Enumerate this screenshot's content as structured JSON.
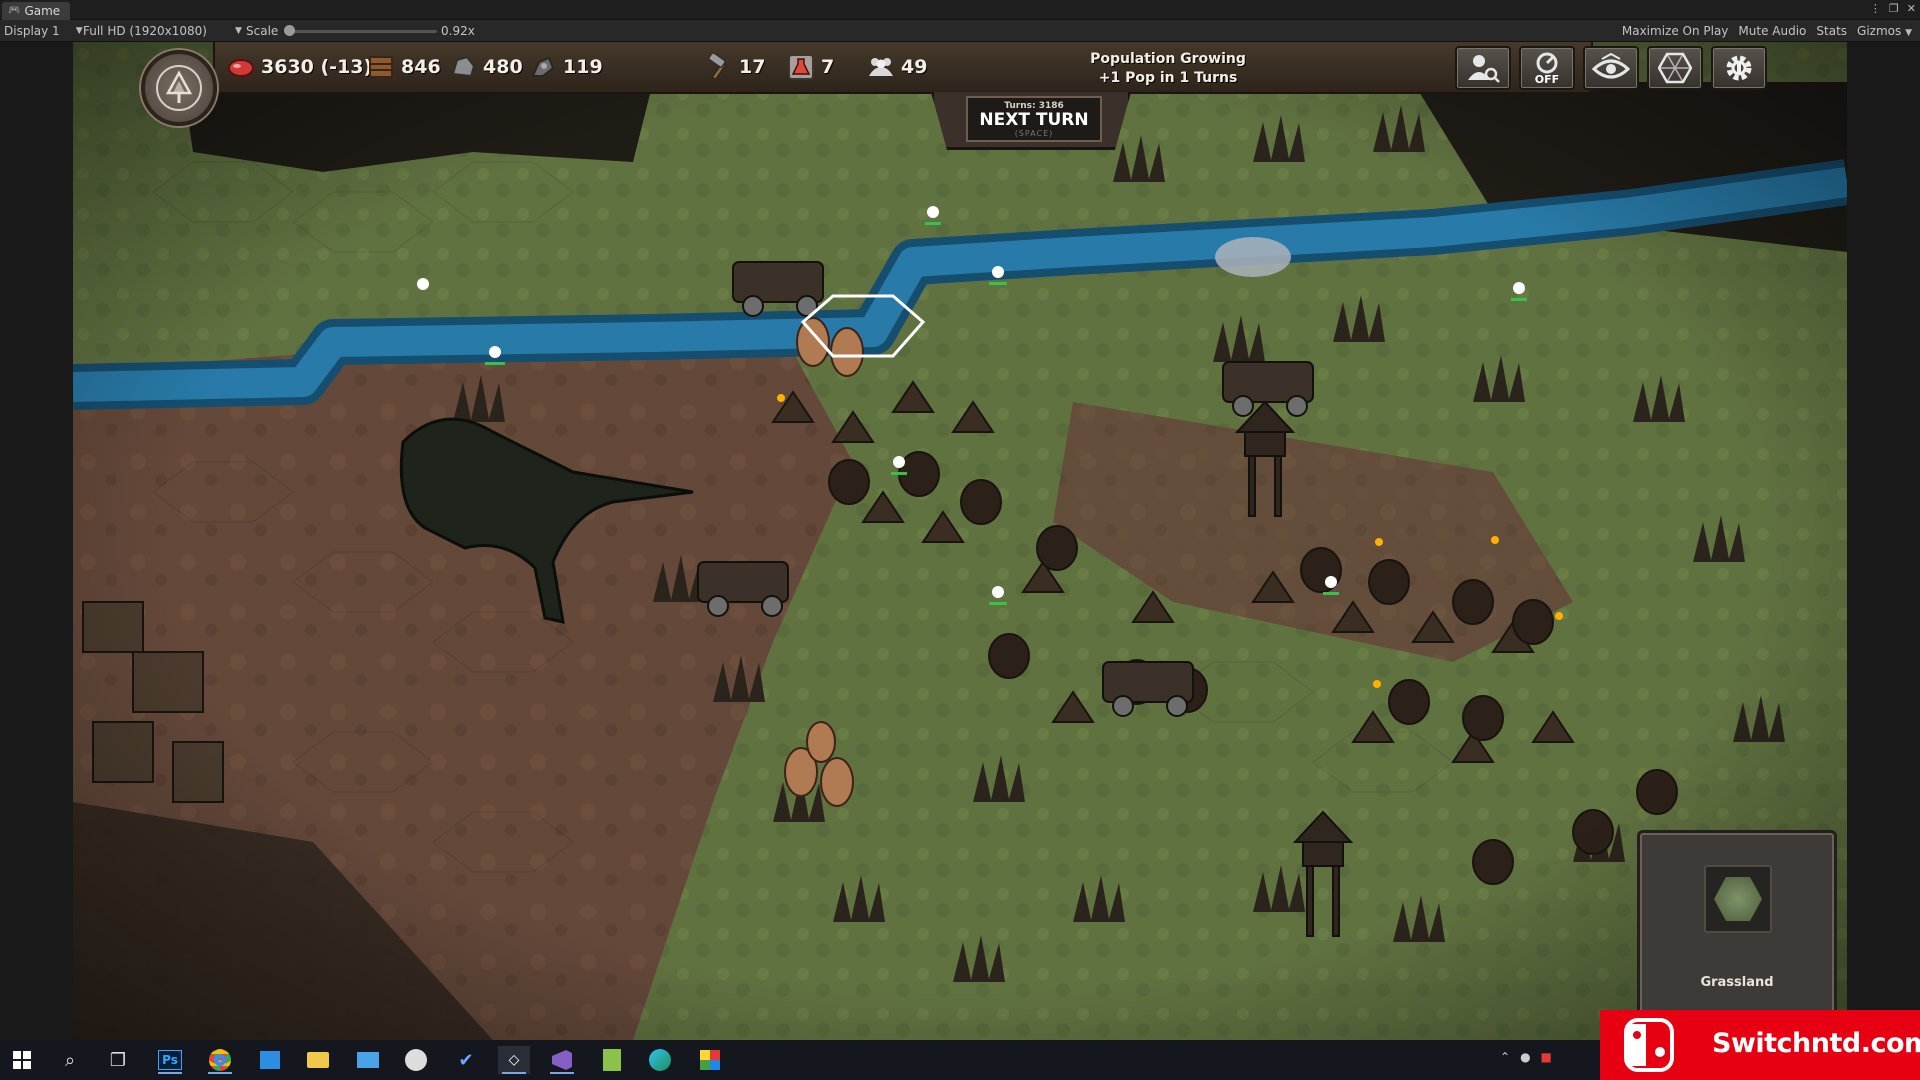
{
  "editor": {
    "tab_label": "Game",
    "display": "Display 1",
    "resolution": "Full HD (1920x1080)",
    "scale_label": "Scale",
    "scale_value": "0.92x",
    "right_options": [
      "Maximize On Play",
      "Mute Audio",
      "Stats",
      "Gizmos"
    ]
  },
  "hud": {
    "resources": {
      "food": "3630 (-13)",
      "wood": "846",
      "stone": "480",
      "ore": "119",
      "production": "17",
      "science": "7",
      "population": "49"
    },
    "status_line1": "Population Growing",
    "status_line2": "+1 Pop in 1 Turns",
    "turns": "Turns: 3186",
    "next_turn": "NEXT TURN",
    "space_hint": "(SPACE)",
    "toggle_state": "OFF"
  },
  "tile_info": {
    "terrain": "Grassland"
  },
  "watermark": {
    "text": "Switchntd.com"
  },
  "colors": {
    "river": "#1f6e9c",
    "grass": "#6a7c45",
    "dirt": "#6a4e3a",
    "hud_bg": "#3b3027",
    "watermark_red": "#e60012"
  },
  "icons": [
    "food-meat-icon",
    "wood-icon",
    "stone-icon",
    "ore-icon",
    "hammer-icon",
    "science-flask-icon",
    "population-icon",
    "worker-search-icon",
    "auto-off-icon",
    "vision-eye-icon",
    "grid-icon",
    "settings-gear-icon"
  ]
}
